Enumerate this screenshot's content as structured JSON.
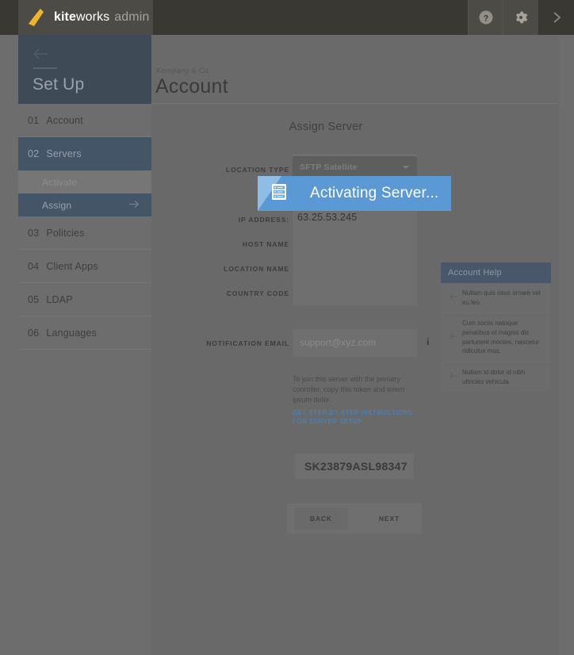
{
  "topbar": {
    "logo_icon": "kite-logo-icon",
    "brand_bold": "kite",
    "brand_regular": "works",
    "brand_suffix": "admin",
    "help_icon": "help-circle-icon",
    "settings_icon": "gear-icon",
    "expand_icon": "chevron-right-icon",
    "bar_color": "#3a3833",
    "logo_block_color": "#4d4b45",
    "logo_kite_color": "#f0b429"
  },
  "sidebar": {
    "back_icon": "back-arrow-icon",
    "title": "Set Up",
    "active_color": "#445568",
    "items": [
      {
        "num": "01",
        "label": "Account",
        "active": false
      },
      {
        "num": "02",
        "label": "Servers",
        "active": true
      },
      {
        "num": "03",
        "label": "Politcies",
        "active": false
      },
      {
        "num": "04",
        "label": "Client Apps",
        "active": false
      },
      {
        "num": "05",
        "label": "LDAP",
        "active": false
      },
      {
        "num": "06",
        "label": "Languages",
        "active": false
      }
    ],
    "subitems": [
      {
        "label": "Activate",
        "state": "dim"
      },
      {
        "label": "Assign",
        "state": "selected",
        "arrow_icon": "arrow-right-icon"
      }
    ]
  },
  "header": {
    "eyebrow": "Kompany & Co",
    "title": "Account"
  },
  "form": {
    "title": "Assign Server",
    "location_type": {
      "label": "LOCATION TYPE",
      "value": "SFTP Satellite",
      "caret_icon": "chevron-down-icon"
    },
    "fields": [
      {
        "label": "IP ADDRESS:",
        "value": "63.25.53.245"
      },
      {
        "label": "HOST NAME",
        "value": ""
      },
      {
        "label": "LOCATION NAME",
        "value": ""
      },
      {
        "label": "COUNTRY CODE",
        "value": ""
      }
    ],
    "notification_email": {
      "label": "NOTIFICATION EMAIL",
      "placeholder": "support@xyz.com",
      "info_icon": "info-icon",
      "info_glyph": "i"
    },
    "join_text": "To join this server with the primary conroller, copy this token and lorem ipsum dolor.",
    "join_link": "GET STEP-BY-STEP INSTRUCTIONS FOR SERVER SETUP",
    "token": "SK23879ASL98347",
    "back_button": "BACK",
    "next_button": "NEXT"
  },
  "help_panel": {
    "title": "Account Help",
    "header_color": "#48576a",
    "items": [
      {
        "arrow_icon": "arrow-left-icon",
        "text": "Nullam quis risus ornare vel eu leo."
      },
      {
        "arrow_icon": "arrow-left-icon",
        "text": "Cum sociis natoque penatibus et magnis dis parturient montes, nascetur ridiculus mus."
      },
      {
        "arrow_icon": "arrow-left-icon",
        "text": "Nullam id dolor id nibh ultricies vehicula."
      }
    ]
  },
  "banner": {
    "icon": "server-rack-icon",
    "message": "Activating Server...",
    "color": "#5b99d4",
    "icon_panel_color": "#8fbde6"
  }
}
